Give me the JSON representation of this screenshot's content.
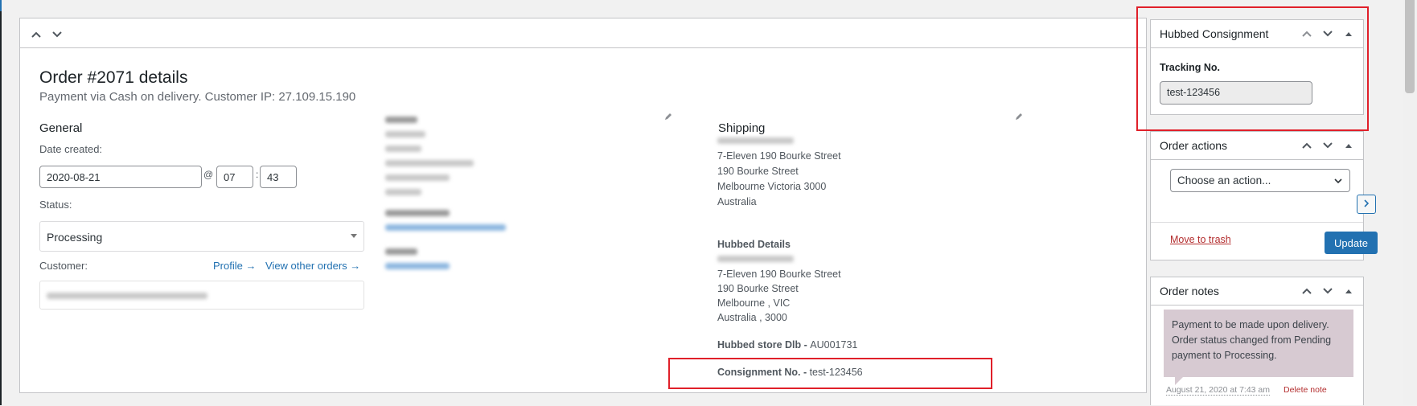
{
  "order": {
    "title": "Order #2071 details",
    "subtitle": "Payment via Cash on delivery. Customer IP: 27.109.15.190"
  },
  "general": {
    "heading": "General",
    "date_label": "Date created:",
    "date_value": "2020-08-21",
    "at_symbol": "@",
    "hour_value": "07",
    "colon": ":",
    "minute_value": "43",
    "status_label": "Status:",
    "status_value": "Processing",
    "customer_label": "Customer:",
    "profile_link": "Profile →",
    "view_orders_link": "View other orders →"
  },
  "shipping": {
    "heading": "Shipping",
    "address_lines": [
      "7-Eleven 190 Bourke Street",
      "190 Bourke Street",
      "Melbourne Victoria 3000",
      "Australia"
    ],
    "hubbed_heading": "Hubbed Details",
    "hubbed_lines": [
      "7-Eleven 190 Bourke Street",
      "190 Bourke Street",
      "Melbourne , VIC",
      "Australia , 3000"
    ],
    "store_label": "Hubbed store Dlb - ",
    "store_value": "AU001731",
    "consignment_label": "Consignment No. - ",
    "consignment_value": "test-123456"
  },
  "sidebar": {
    "hubbed": {
      "title": "Hubbed Consignment",
      "tracking_label": "Tracking No.",
      "tracking_value": "test-123456"
    },
    "actions": {
      "title": "Order actions",
      "select_value": "Choose an action...",
      "trash_link": "Move to trash",
      "update_label": "Update"
    },
    "notes": {
      "title": "Order notes",
      "note_text": "Payment to be made upon delivery. Order status changed from Pending payment to Processing.",
      "note_date": "August 21, 2020 at 7:43 am",
      "delete_link": "Delete note"
    }
  },
  "colors": {
    "accent": "#2271b1",
    "highlight_red": "#e0202a",
    "note_bg": "#d7cad2",
    "danger_link": "#b32d2e"
  },
  "icons": [
    "chevron-up-icon",
    "chevron-down-icon",
    "pencil-icon",
    "caret-up-icon",
    "chevron-right-icon",
    "dropdown-caret-icon"
  ]
}
